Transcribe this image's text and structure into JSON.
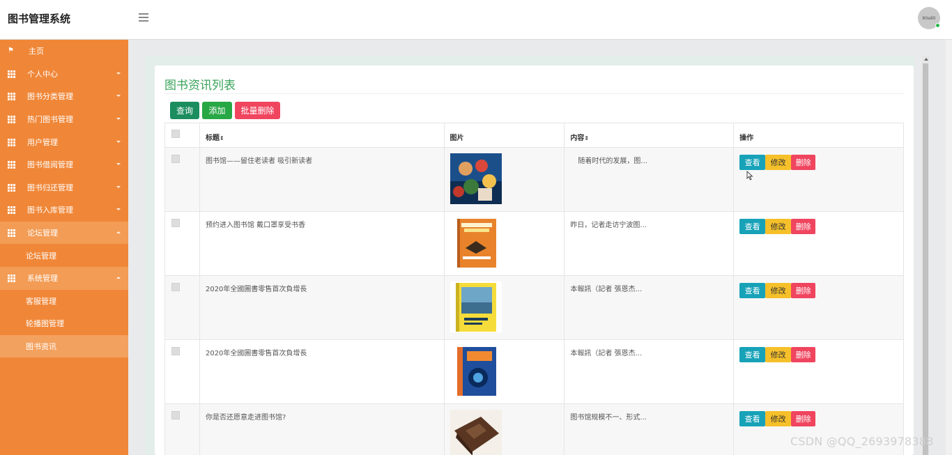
{
  "header": {
    "brand": "图书管理系统",
    "menu_icon": "hamburger-icon",
    "avatar_text": "80a80"
  },
  "sidebar": {
    "items": [
      {
        "label": "主页",
        "icon": "flag-icon",
        "caret": "none"
      },
      {
        "label": "个人中心",
        "icon": "grid-icon",
        "caret": "down"
      },
      {
        "label": "图书分类管理",
        "icon": "grid-icon",
        "caret": "down"
      },
      {
        "label": "热门图书管理",
        "icon": "grid-icon",
        "caret": "down"
      },
      {
        "label": "用户管理",
        "icon": "grid-icon",
        "caret": "down"
      },
      {
        "label": "图书借阅管理",
        "icon": "grid-icon",
        "caret": "down"
      },
      {
        "label": "图书归还管理",
        "icon": "grid-icon",
        "caret": "down"
      },
      {
        "label": "图书入库管理",
        "icon": "grid-icon",
        "caret": "down"
      },
      {
        "label": "论坛管理",
        "icon": "grid-icon",
        "caret": "up",
        "children": [
          "论坛管理"
        ]
      },
      {
        "label": "系统管理",
        "icon": "grid-icon",
        "caret": "up",
        "children": [
          "客服管理",
          "轮播图管理",
          "图书资讯"
        ]
      }
    ],
    "active_child": "图书资讯"
  },
  "page": {
    "title": "图书资讯列表",
    "buttons": {
      "query": "查询",
      "add": "添加",
      "batch_delete": "批量删除"
    }
  },
  "table": {
    "headers": {
      "title": "标题",
      "image": "图片",
      "content": "内容",
      "actions": "操作"
    },
    "sort_symbol": "⇕",
    "action_labels": {
      "view": "查看",
      "edit": "修改",
      "delete": "删除"
    },
    "rows": [
      {
        "title": "图书馆——留住老读者 吸引新读者",
        "content": "随着时代的发展，图...",
        "image": "anime-poster"
      },
      {
        "title": "预约进入图书馆 戴口罩享受书香",
        "content": "昨日，记者走访宁波图...",
        "image": "memory-book-orange"
      },
      {
        "title": "2020年全國圖書零售首次負增長",
        "content": "本報訊（記者 張恩杰...",
        "image": "book-yellow-blue"
      },
      {
        "title": "2020年全國圖書零售首次負增長",
        "content": "本報訊（記者 張恩杰...",
        "image": "memory-book-blue"
      },
      {
        "title": "你是否还愿意走进图书馆?",
        "content": "图书馆规模不一、形式...",
        "image": "old-leather-book"
      }
    ]
  },
  "watermark": "CSDN @QQ_2693978388",
  "colors": {
    "sidebar": "#f08738",
    "title": "#3aa35a",
    "view": "#17a2b8",
    "edit": "#f6c02a",
    "delete": "#f0455f"
  }
}
